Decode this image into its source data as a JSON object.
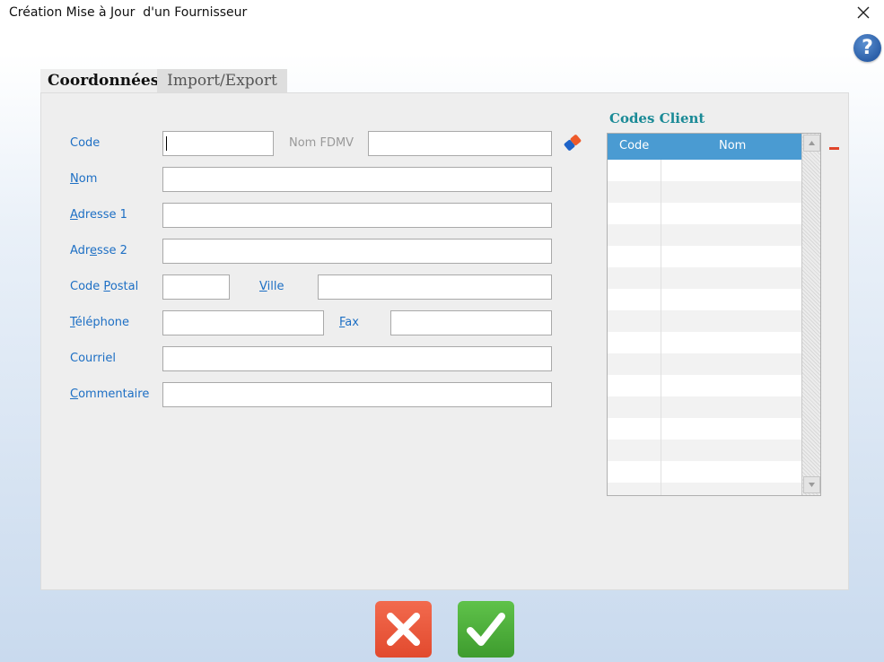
{
  "window": {
    "title": "Création Mise à Jour  d'un Fournisseur"
  },
  "tabs": [
    {
      "label": "Coordonnées",
      "active": true
    },
    {
      "label": "Import/Export",
      "active": false
    }
  ],
  "help": {
    "label": "?"
  },
  "form": {
    "code": {
      "label": "Code",
      "value": ""
    },
    "nom_fdmv": {
      "label": "Nom FDMV",
      "value": ""
    },
    "nom": {
      "label_mnemonic": "N",
      "label_rest": "om",
      "value": ""
    },
    "adresse1": {
      "label_mnemonic": "A",
      "label_rest": "dresse 1",
      "value": ""
    },
    "adresse2": {
      "label_pre": "Adr",
      "label_mnemonic": "e",
      "label_rest": "sse 2",
      "value": ""
    },
    "code_postal": {
      "label_pre": "Code ",
      "label_mnemonic": "P",
      "label_rest": "ostal",
      "value": ""
    },
    "ville": {
      "label_mnemonic": "V",
      "label_rest": "ille",
      "value": ""
    },
    "telephone": {
      "label_mnemonic": "T",
      "label_rest": "éléphone",
      "value": ""
    },
    "fax": {
      "label_mnemonic": "F",
      "label_rest": "ax",
      "value": ""
    },
    "courriel": {
      "label": "Courriel",
      "value": ""
    },
    "commentaire": {
      "label_mnemonic": "C",
      "label_rest": "ommentaire",
      "value": ""
    }
  },
  "codes_client": {
    "title": "Codes Client",
    "columns": [
      "Code",
      "Nom"
    ],
    "rows": []
  },
  "colors": {
    "label_blue": "#1d6fc4",
    "grid_header": "#4a9bd2",
    "cancel_red": "#e24a2e",
    "ok_green": "#3e9c2e"
  }
}
